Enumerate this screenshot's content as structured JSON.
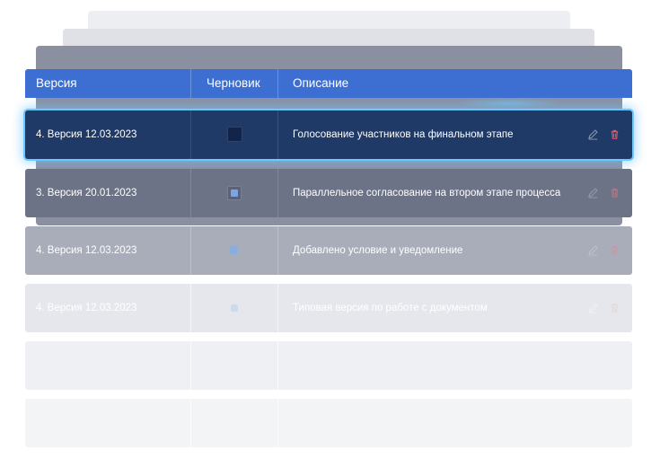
{
  "table": {
    "columns": {
      "version": "Версия",
      "draft": "Черновик",
      "description": "Описание"
    },
    "rows": [
      {
        "version": "4. Версия 12.03.2023",
        "draft_checked": false,
        "description": "Голосование участников на финальном этапе",
        "selected": true
      },
      {
        "version": "3. Версия 20.01.2023",
        "draft_checked": true,
        "description": "Параллельное согласование на втором этапе процесса",
        "selected": false
      },
      {
        "version": "4. Версия 12.03.2023",
        "draft_checked": true,
        "description": "Добавлено условие и уведомление",
        "selected": false
      },
      {
        "version": "4. Версия 12.03.2023",
        "draft_checked": true,
        "description": "Типовая версия по работе с документом",
        "selected": false
      }
    ],
    "row_icons": {
      "edit": "pencil-icon",
      "delete": "trash-icon"
    }
  },
  "colors": {
    "header": "#3d6fd2",
    "selected_row": "#1f3a66",
    "selection_glow": "#6cc8ff",
    "delete_icon": "#e85a68"
  }
}
